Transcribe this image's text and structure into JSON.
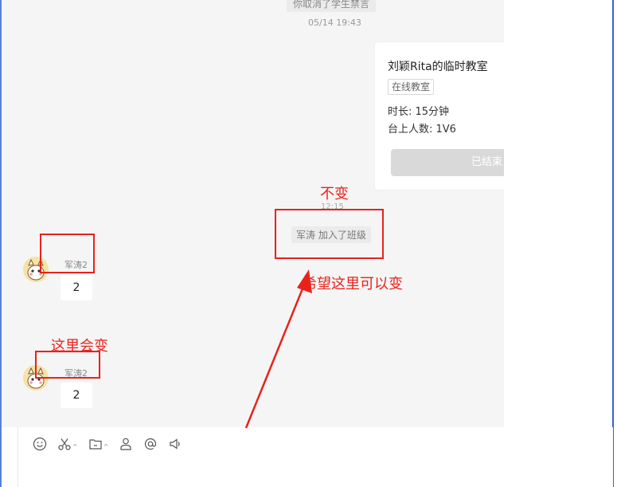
{
  "chat": {
    "top_note": "你取消了学生禁言",
    "top_time": "05/14 19:43",
    "card": {
      "title": "刘颖Rita的临时教室",
      "tag": "在线教室",
      "duration": "时长: 15分钟",
      "stage": "台上人数: 1V6",
      "button_label": "已结束"
    },
    "mid_time": "12:15",
    "join_notice": "军涛 加入了班级",
    "messages": [
      {
        "sender": "军涛2",
        "text": "2"
      },
      {
        "sender": "军涛2",
        "text": "2"
      }
    ]
  },
  "toolbar": {
    "icons": [
      "emoji-icon",
      "scissors-icon",
      "folder-icon",
      "user-icon",
      "at-icon",
      "speaker-icon"
    ]
  },
  "annotations": {
    "unchanged": "不变",
    "will_change": "这里会变",
    "hope_change": "希望这里可以变"
  },
  "colors": {
    "annotation": "#e8221b",
    "chat_bg": "#f5f5f5",
    "frame": "#3a5fd4"
  }
}
